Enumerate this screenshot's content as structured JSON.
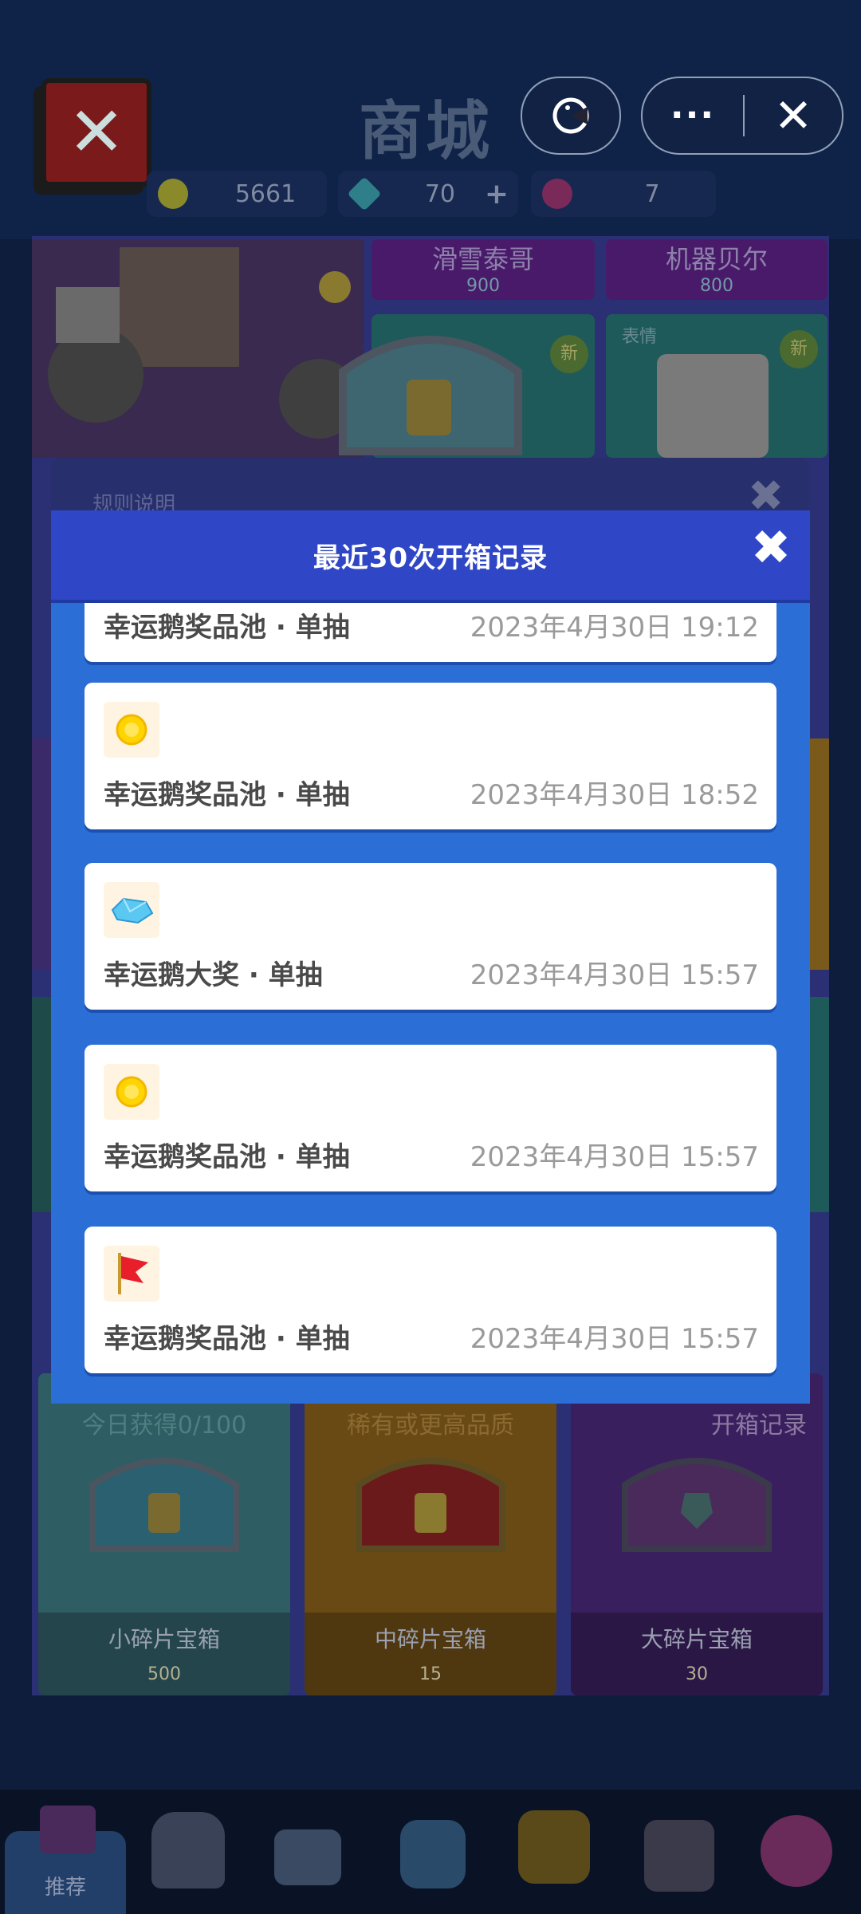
{
  "store": {
    "title": "商城",
    "currency": [
      {
        "icon": "coin-icon",
        "value": "5661"
      },
      {
        "icon": "diamond-icon",
        "value": "70",
        "plus": "+"
      },
      {
        "icon": "lotus-icon",
        "value": "7"
      }
    ],
    "items": [
      {
        "name": "滑雪泰哥",
        "price": "900"
      },
      {
        "name": "机器贝尔",
        "price": "800"
      }
    ],
    "tag_emote": "表情",
    "badge_new": "新",
    "chests": [
      {
        "name": "小碎片宝箱",
        "price": "500",
        "note": "今日获得0/100"
      },
      {
        "name": "中碎片宝箱",
        "price": "15",
        "note": "稀有或更高品质"
      },
      {
        "name": "大碎片宝箱",
        "price": "30",
        "note": "开箱记录"
      }
    ],
    "nav_active_label": "推荐"
  },
  "rule_dialog": {
    "title": "规则说明"
  },
  "modal": {
    "title": "最近30次开箱记录",
    "records": [
      {
        "icon": "coin-icon",
        "name": "幸运鹅奖品池 · 单抽",
        "time": "2023年4月30日 19:12"
      },
      {
        "icon": "coin-icon",
        "name": "幸运鹅奖品池 · 单抽",
        "time": "2023年4月30日 18:52"
      },
      {
        "icon": "diamond-icon",
        "name": "幸运鹅大奖 · 单抽",
        "time": "2023年4月30日 15:57"
      },
      {
        "icon": "coin-icon",
        "name": "幸运鹅奖品池 · 单抽",
        "time": "2023年4月30日 15:57"
      },
      {
        "icon": "red-flag-icon",
        "name": "幸运鹅奖品池 · 单抽",
        "time": "2023年4月30日 15:57"
      }
    ]
  }
}
